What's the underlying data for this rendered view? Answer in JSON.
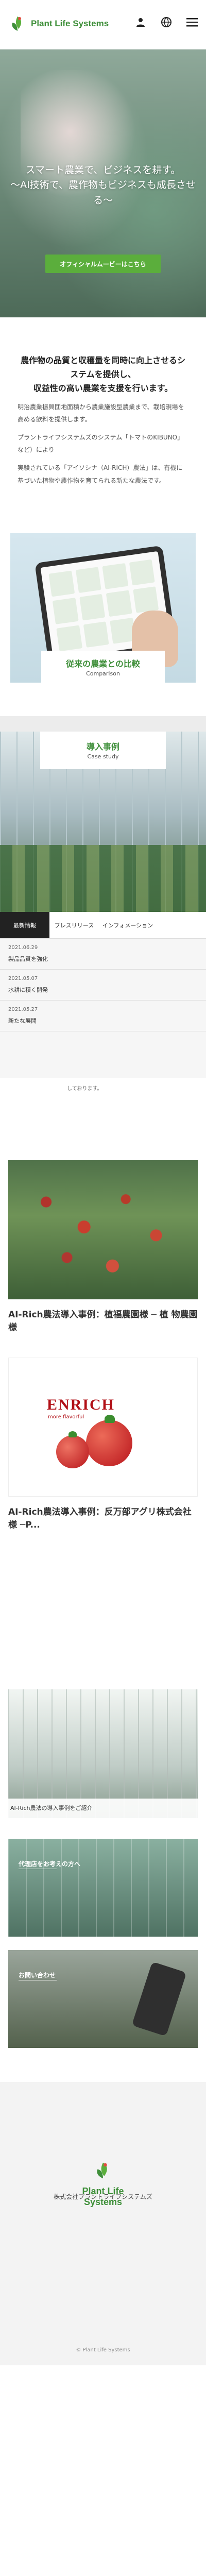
{
  "header": {
    "logo_text": "Plant Life Systems",
    "icons": [
      "user-icon",
      "globe-icon",
      "menu-icon"
    ]
  },
  "hero": {
    "copy_line1": "スマート農業で、ビジネスを耕す。",
    "copy_line2": "～AI技術で、農作物もビジネスも成長させる～",
    "button_label": "オフィシャルムービーはこちら"
  },
  "intro": {
    "heading_line1": "農作物の品質と収穫量を同時に向上させるシステムを提供し、",
    "heading_line2": "収益性の高い農業を支援を行います。",
    "body1": "明治農業振興団地面積から農業施設型農業まで、栽培現場を高める飲料を提供します。",
    "body2": "プラントライフシステムズのシステム「トマトのKIBUNO」など）により",
    "body3": "実験されている「アイソシナ（AI-RICH）農法」は、有機に基づいた植物や農作物を育てられる新たな農法です。"
  },
  "compare": {
    "title": "従来の農業との比較",
    "subtitle": "Comparison"
  },
  "case_header": {
    "title": "導入事例",
    "subtitle": "Case study"
  },
  "news": {
    "tabs": [
      "最新情報",
      "プレスリリース",
      "インフォメーション"
    ],
    "items": [
      {
        "date": "2021.06.29",
        "title": "製品品質を強化"
      },
      {
        "date": "2021.05.07",
        "title": "水耕に積く開発"
      },
      {
        "date": "2021.05.27",
        "title": "新たな展開"
      }
    ],
    "note": "しております。"
  },
  "cases": [
    {
      "title": "AI-Rich農法導入事例：植福農園様 ─ 植 物農園様"
    },
    {
      "title": "AI-Rich農法導入事例：反万部アグリ株式会社 様 ─P..."
    }
  ],
  "enrich": {
    "brand": "ENRICH",
    "tagline": "more flavorful"
  },
  "category_card": {
    "title": "AI-Rich農法の導入事例をご紹介"
  },
  "banners": [
    {
      "label": "代理店をお考えの方へ"
    },
    {
      "label": "お問い合わせ"
    }
  ],
  "footer": {
    "logo_text": "Plant Life Systems",
    "company": "株式会社プラントライフシステムズ",
    "copyright": "© Plant Life Systems"
  },
  "colors": {
    "brand": "#3f8f3a",
    "accent_button": "#5bae3c"
  }
}
